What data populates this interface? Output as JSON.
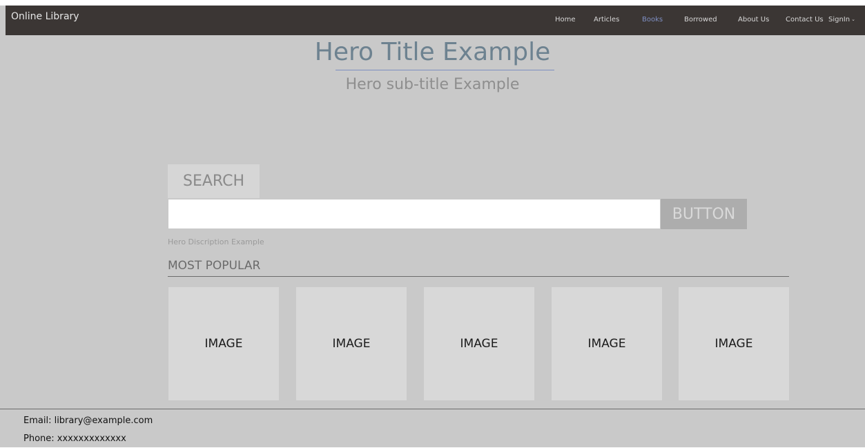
{
  "navbar": {
    "brand": "Online Library",
    "items": [
      {
        "label": "Home"
      },
      {
        "label": "Articles"
      },
      {
        "label": "Books"
      },
      {
        "label": "Borrowed"
      },
      {
        "label": "About Us"
      },
      {
        "label": "Contact Us"
      },
      {
        "label": "SignIn"
      }
    ],
    "active": "Books"
  },
  "hero": {
    "title": "Hero Title Example",
    "subtitle": "Hero sub-title Example",
    "search_label": "SEARCH",
    "search_value": "",
    "button_label": "BUTTON",
    "description": "Hero Discription Example"
  },
  "popular": {
    "heading": "MOST POPULAR",
    "cards": [
      {
        "label": "IMAGE"
      },
      {
        "label": "IMAGE"
      },
      {
        "label": "IMAGE"
      },
      {
        "label": "IMAGE"
      },
      {
        "label": "IMAGE"
      }
    ]
  },
  "footer": {
    "email": "Email: library@example.com",
    "phone": "Phone: xxxxxxxxxxxxx"
  },
  "colors": {
    "navbar_bg": "#3b3634",
    "page_bg": "#c9c9c9",
    "active_nav": "#7f8fc4",
    "hero_title": "#6d8290"
  }
}
